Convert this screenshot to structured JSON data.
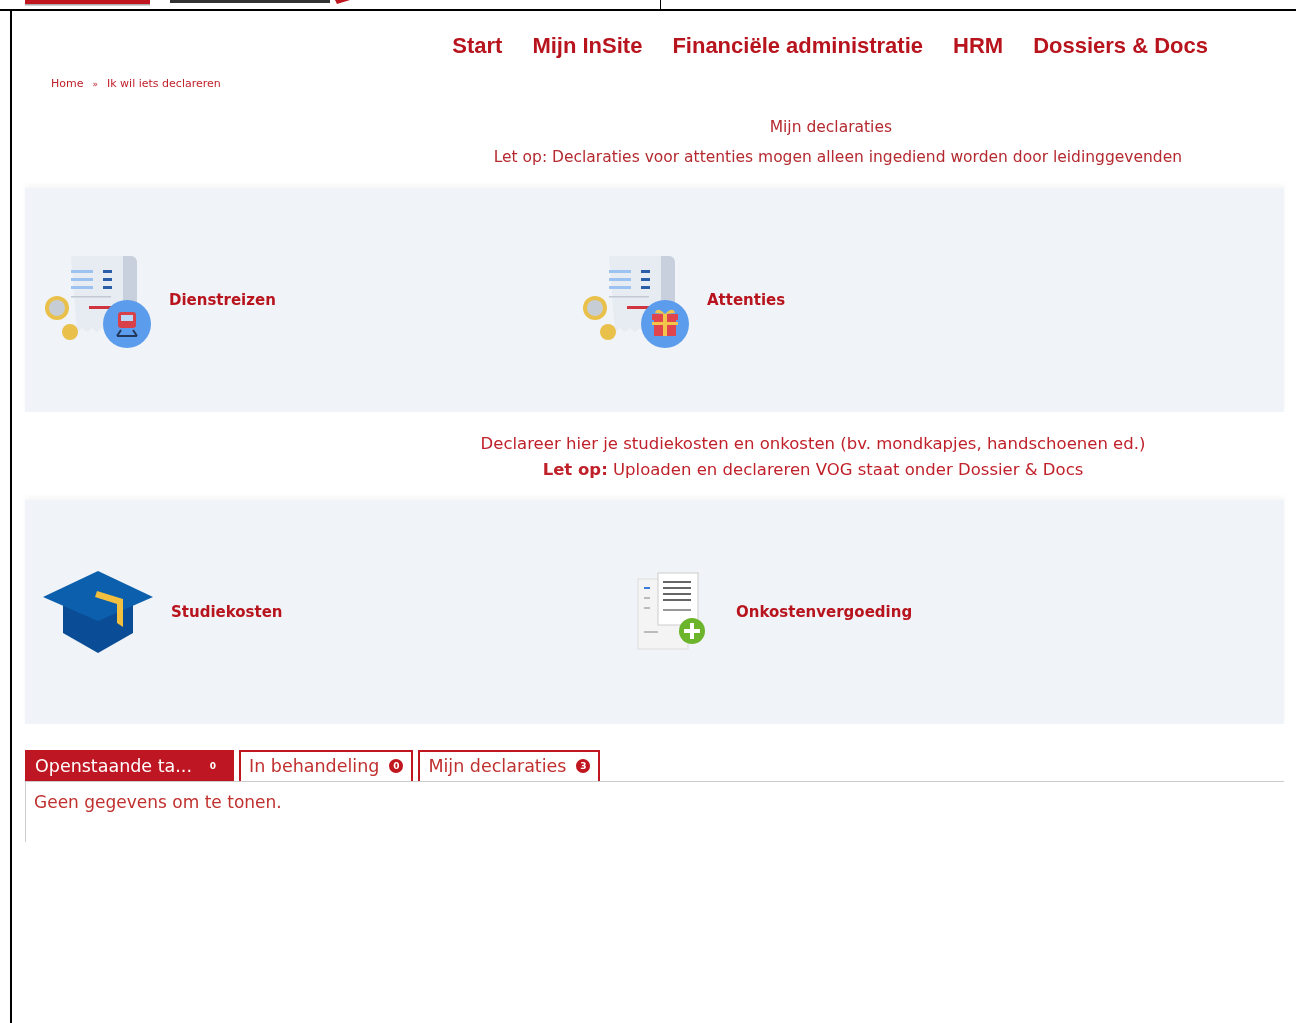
{
  "nav": [
    {
      "label": "Start"
    },
    {
      "label": "Mijn InSite"
    },
    {
      "label": "Financiële administratie"
    },
    {
      "label": "HRM"
    },
    {
      "label": "Dossiers & Docs"
    }
  ],
  "breadcrumb": {
    "items": [
      "Home",
      "Ik wil iets declareren"
    ],
    "separator": "»"
  },
  "section_1": {
    "lines": [
      "Mijn declaraties",
      "Let op: Declaraties voor attenties mogen alleen ingediend worden door leidinggevenden"
    ],
    "tiles": [
      {
        "label": "Dienstreizen"
      },
      {
        "label": "Attenties"
      }
    ]
  },
  "section_2": {
    "lines": [
      "Declareer hier je studiekosten en onkosten (bv. mondkapjes, handschoenen ed.)",
      "**Let op:** Uploaden en declareren VOG staat onder Dossier & Docs"
    ],
    "tiles": [
      {
        "label": "Studiekosten"
      },
      {
        "label": "Onkostenvergoeding"
      }
    ]
  },
  "tabs": [
    {
      "label": "Openstaande ta...",
      "count": "0",
      "selected": true
    },
    {
      "label": "In behandeling",
      "count": "0",
      "selected": false
    },
    {
      "label": "Mijn declaraties",
      "count": "3",
      "selected": false
    }
  ],
  "empty_message": "Geen gegevens om te tonen."
}
